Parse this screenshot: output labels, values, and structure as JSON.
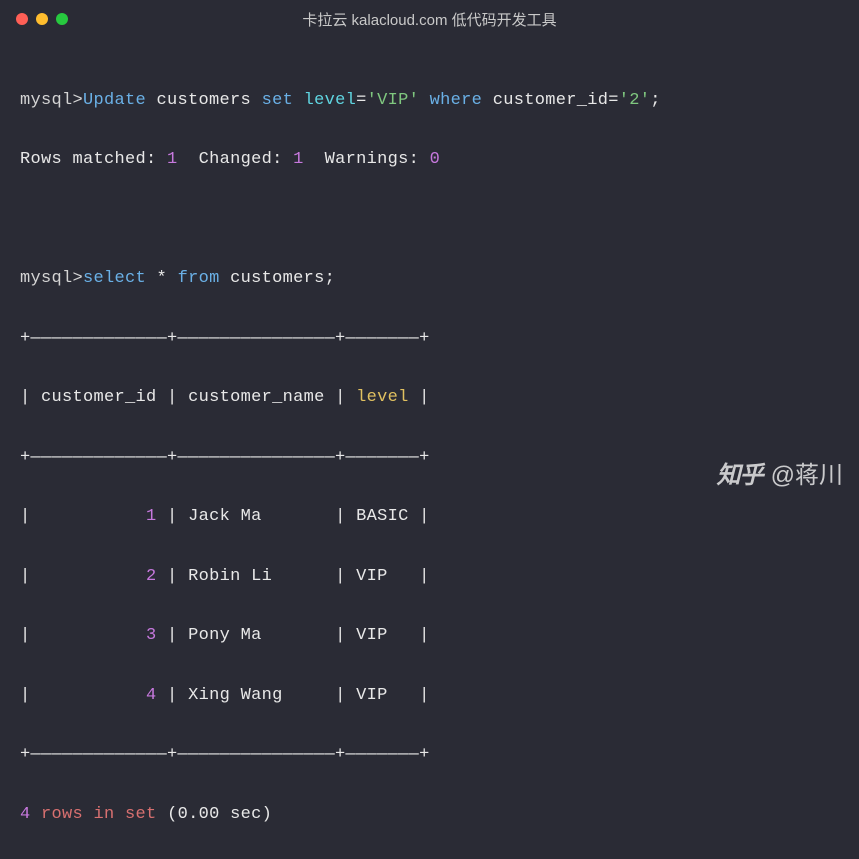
{
  "titlebar": {
    "title": "卡拉云 kalacloud.com 低代码开发工具"
  },
  "prompt": "mysql>",
  "query1": {
    "kw_update": "Update",
    "table": "customers",
    "kw_set": "set",
    "col_assign": "level",
    "eq": "=",
    "val1": "'VIP'",
    "kw_where": "where",
    "col_where": "customer_id",
    "val2": "'2'",
    "semi": ";"
  },
  "result1": {
    "rows_matched_label": "Rows matched:",
    "rows_matched_val": "1",
    "changed_label": "Changed:",
    "changed_val": "1",
    "warnings_label": "Warnings:",
    "warnings_val": "0"
  },
  "query2": {
    "kw_select": "select",
    "star": "*",
    "kw_from": "from",
    "table": "customers",
    "semi": ";"
  },
  "table": {
    "border_top": "+—————————————+———————————————+———————+",
    "border_mid": "+—————————————+———————————————+———————+",
    "border_bot": "+—————————————+———————————————+———————+",
    "pipe": "|",
    "headers": {
      "c1": " customer_id ",
      "c2": " customer_name ",
      "c3": " level "
    },
    "rows": [
      {
        "c1": "           1 ",
        "c2": " Jack Ma       ",
        "c3": " BASIC "
      },
      {
        "c1": "           2 ",
        "c2": " Robin Li      ",
        "c3": " VIP   "
      },
      {
        "c1": "           3 ",
        "c2": " Pony Ma       ",
        "c3": " VIP   "
      },
      {
        "c1": "           4 ",
        "c2": " Xing Wang     ",
        "c3": " VIP   "
      }
    ]
  },
  "footer": {
    "count": "4",
    "rows_in_set": "rows in set",
    "time": "(0.00 sec)"
  },
  "watermark": {
    "logo": "知乎",
    "at": "@蒋川"
  }
}
